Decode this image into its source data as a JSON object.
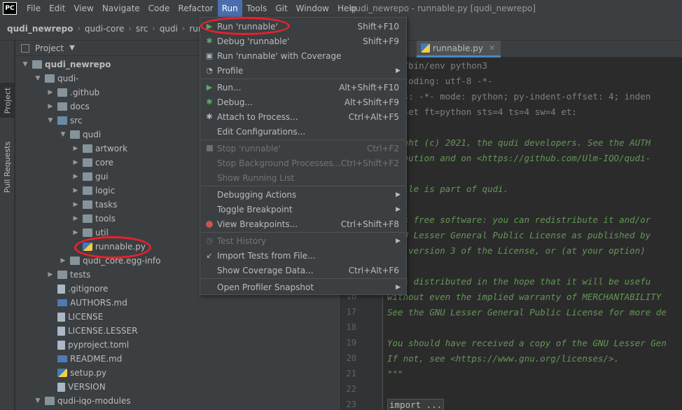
{
  "app": {
    "logo_text": "PC"
  },
  "menubar": {
    "items": [
      "File",
      "Edit",
      "View",
      "Navigate",
      "Code",
      "Refactor",
      "Run",
      "Tools",
      "Git",
      "Window",
      "Help"
    ],
    "window_title": "qudi_newrepo - runnable.py [qudi_newrepo]"
  },
  "breadcrumbs": [
    "qudi_newrepo",
    "qudi-core",
    "src",
    "qudi",
    "runn"
  ],
  "side_stripe": {
    "project": "Project",
    "pull_requests": "Pull Requests"
  },
  "project_panel": {
    "title": "Project",
    "tree": [
      {
        "label": "qudi_newrepo",
        "depth": 0,
        "type": "folder",
        "expanded": true,
        "bold": true
      },
      {
        "label": "qudi-",
        "depth": 1,
        "type": "folder",
        "expanded": true
      },
      {
        "label": ".github",
        "depth": 2,
        "type": "folder",
        "expanded": false
      },
      {
        "label": "docs",
        "depth": 2,
        "type": "folder",
        "expanded": false
      },
      {
        "label": "src",
        "depth": 2,
        "type": "folder-src",
        "expanded": true
      },
      {
        "label": "qudi",
        "depth": 3,
        "type": "folder",
        "expanded": true
      },
      {
        "label": "artwork",
        "depth": 4,
        "type": "folder",
        "expanded": false
      },
      {
        "label": "core",
        "depth": 4,
        "type": "folder",
        "expanded": false
      },
      {
        "label": "gui",
        "depth": 4,
        "type": "folder",
        "expanded": false
      },
      {
        "label": "logic",
        "depth": 4,
        "type": "folder",
        "expanded": false
      },
      {
        "label": "tasks",
        "depth": 4,
        "type": "folder",
        "expanded": false
      },
      {
        "label": "tools",
        "depth": 4,
        "type": "folder",
        "expanded": false
      },
      {
        "label": "util",
        "depth": 4,
        "type": "folder",
        "expanded": false
      },
      {
        "label": "runnable.py",
        "depth": 4,
        "type": "py",
        "leaf": true
      },
      {
        "label": "qudi_core.egg-info",
        "depth": 3,
        "type": "folder",
        "expanded": false
      },
      {
        "label": "tests",
        "depth": 2,
        "type": "folder",
        "expanded": false
      },
      {
        "label": ".gitignore",
        "depth": 2,
        "type": "file",
        "leaf": true
      },
      {
        "label": "AUTHORS.md",
        "depth": 2,
        "type": "md",
        "leaf": true
      },
      {
        "label": "LICENSE",
        "depth": 2,
        "type": "file",
        "leaf": true
      },
      {
        "label": "LICENSE.LESSER",
        "depth": 2,
        "type": "file",
        "leaf": true
      },
      {
        "label": "pyproject.toml",
        "depth": 2,
        "type": "file",
        "leaf": true
      },
      {
        "label": "README.md",
        "depth": 2,
        "type": "md",
        "leaf": true
      },
      {
        "label": "setup.py",
        "depth": 2,
        "type": "py",
        "leaf": true
      },
      {
        "label": "VERSION",
        "depth": 2,
        "type": "file",
        "leaf": true
      },
      {
        "label": "qudi-iqo-modules",
        "depth": 1,
        "type": "folder",
        "expanded": true
      }
    ]
  },
  "editor": {
    "tab_label": "runnable.py",
    "lines": [
      {
        "num": "",
        "cls": "c-comment",
        "text": "usr/bin/env python3"
      },
      {
        "num": "",
        "cls": "c-comment",
        "text": "*- coding: utf-8 -*-"
      },
      {
        "num": "",
        "cls": "c-comment",
        "text": "macs: -*- mode: python; py-indent-offset: 4; inden"
      },
      {
        "num": "",
        "cls": "c-comment",
        "text": "i: set ft=python sts=4 ts=4 sw=4 et:"
      },
      {
        "num": "",
        "cls": "",
        "text": ""
      },
      {
        "num": "",
        "cls": "c-doc",
        "text": "yright (c) 2021, the qudi developers. See the AUTH"
      },
      {
        "num": "",
        "cls": "c-doc",
        "text": "tribution and on <https://github.com/Ulm-IQO/qudi-"
      },
      {
        "num": "",
        "cls": "",
        "text": ""
      },
      {
        "num": "",
        "cls": "c-doc",
        "text": "s file is part of qudi."
      },
      {
        "num": "",
        "cls": "",
        "text": ""
      },
      {
        "num": "",
        "cls": "c-doc",
        "text": "i is free software: you can redistribute it and/or"
      },
      {
        "num": "",
        "cls": "c-doc",
        "text": " GNU Lesser General Public License as published by"
      },
      {
        "num": "",
        "cls": "c-doc",
        "text": "her version 3 of the License, or (at your option)"
      },
      {
        "num": "",
        "cls": "",
        "text": ""
      },
      {
        "num": "",
        "cls": "c-doc",
        "text": "i is distributed in the hope that it will be usefu"
      },
      {
        "num": "16",
        "cls": "c-doc",
        "text": "without even the implied warranty of MERCHANTABILITY"
      },
      {
        "num": "17",
        "cls": "c-doc",
        "text": "See the GNU Lesser General Public License for more de"
      },
      {
        "num": "18",
        "cls": "",
        "text": ""
      },
      {
        "num": "19",
        "cls": "c-doc",
        "text": "You should have received a copy of the GNU Lesser Gen"
      },
      {
        "num": "20",
        "cls": "c-doc",
        "text": "If not, see <https://www.gnu.org/licenses/>."
      },
      {
        "num": "21",
        "cls": "c-doc",
        "text": "\"\"\""
      },
      {
        "num": "22",
        "cls": "",
        "text": ""
      },
      {
        "num": "23",
        "cls": "c-fold",
        "text": "import ..."
      }
    ]
  },
  "run_menu": {
    "items": [
      {
        "label": "Run 'runnable'",
        "shortcut": "Shift+F10",
        "icon": "run-icon",
        "glyph": "▶",
        "disabled": false
      },
      {
        "label": "Debug 'runnable'",
        "shortcut": "Shift+F9",
        "icon": "debug-icon",
        "glyph": "✱",
        "disabled": false
      },
      {
        "label": "Run 'runnable' with Coverage",
        "shortcut": "",
        "icon": "coverage-icon",
        "glyph": "▣",
        "disabled": false
      },
      {
        "label": "Profile",
        "shortcut": "",
        "icon": "profile-icon",
        "glyph": "◔",
        "disabled": false,
        "submenu": true,
        "sep_after": true
      },
      {
        "label": "Run...",
        "shortcut": "Alt+Shift+F10",
        "icon": "run-icon",
        "glyph": "▶",
        "disabled": false
      },
      {
        "label": "Debug...",
        "shortcut": "Alt+Shift+F9",
        "icon": "debug-icon",
        "glyph": "✱",
        "disabled": false
      },
      {
        "label": "Attach to Process...",
        "shortcut": "Ctrl+Alt+F5",
        "icon": "attach-icon",
        "glyph": "✱",
        "disabled": false
      },
      {
        "label": "Edit Configurations...",
        "shortcut": "",
        "icon": "",
        "glyph": "",
        "disabled": false,
        "sep_after": true
      },
      {
        "label": "Stop 'runnable'",
        "shortcut": "Ctrl+F2",
        "icon": "stop-icon",
        "glyph": "",
        "disabled": true
      },
      {
        "label": "Stop Background Processes...",
        "shortcut": "Ctrl+Shift+F2",
        "icon": "",
        "glyph": "",
        "disabled": true
      },
      {
        "label": "Show Running List",
        "shortcut": "",
        "icon": "",
        "glyph": "",
        "disabled": true,
        "sep_after": true
      },
      {
        "label": "Debugging Actions",
        "shortcut": "",
        "icon": "",
        "glyph": "",
        "disabled": false,
        "submenu": true
      },
      {
        "label": "Toggle Breakpoint",
        "shortcut": "",
        "icon": "",
        "glyph": "",
        "disabled": false,
        "submenu": true
      },
      {
        "label": "View Breakpoints...",
        "shortcut": "Ctrl+Shift+F8",
        "icon": "breakpoint-icon",
        "glyph": "",
        "disabled": false,
        "sep_after": true
      },
      {
        "label": "Test History",
        "shortcut": "",
        "icon": "history-icon",
        "glyph": "◷",
        "disabled": true,
        "submenu": true
      },
      {
        "label": "Import Tests from File...",
        "shortcut": "",
        "icon": "import-icon",
        "glyph": "↙",
        "disabled": false
      },
      {
        "label": "Show Coverage Data...",
        "shortcut": "Ctrl+Alt+F6",
        "icon": "",
        "glyph": "",
        "disabled": false,
        "sep_after": true
      },
      {
        "label": "Open Profiler Snapshot",
        "shortcut": "",
        "icon": "",
        "glyph": "",
        "disabled": false,
        "submenu": true
      }
    ]
  },
  "colors": {
    "menu_highlight": "#4b6eaf",
    "annotation": "#e8212d",
    "run_green": "#59a869"
  }
}
